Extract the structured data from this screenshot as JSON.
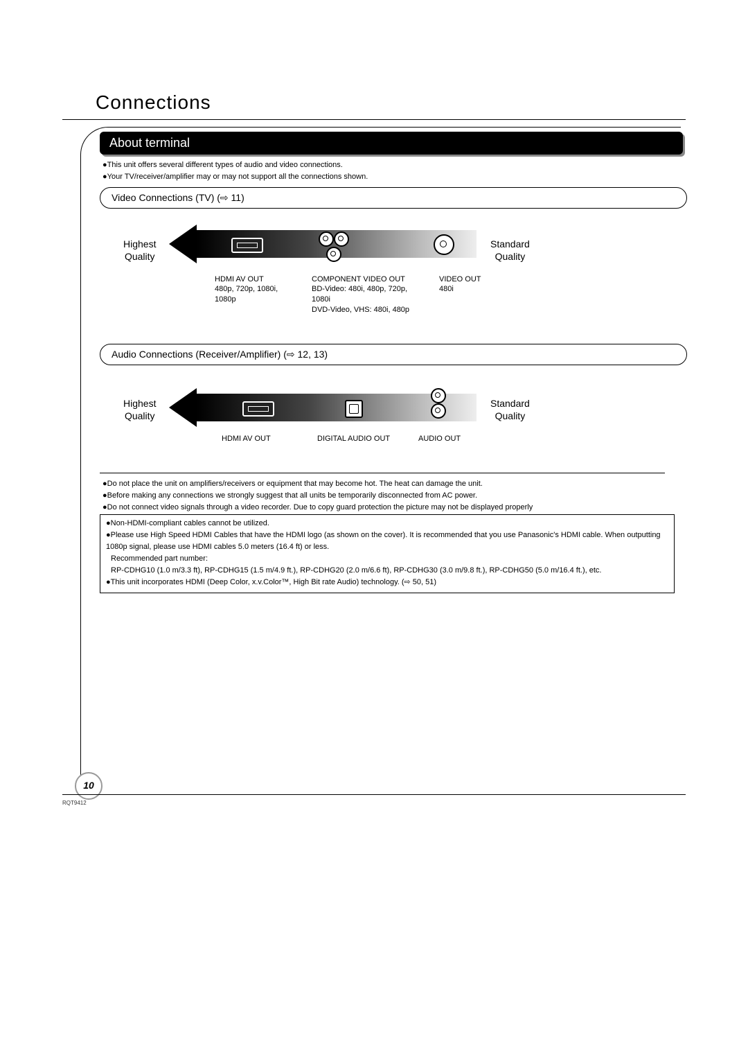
{
  "title": "Connections",
  "section_header": "About terminal",
  "intro_bullets": [
    "This unit offers several different types of audio and video connections.",
    "Your TV/receiver/amplifier may or may not support all the connections shown."
  ],
  "video": {
    "pill": "Video Connections (TV) (⇨ 11)",
    "highest": "Highest\nQuality",
    "standard": "Standard\nQuality",
    "cols": [
      {
        "name": "HDMI AV OUT",
        "detail": "480p, 720p, 1080i,\n1080p"
      },
      {
        "name": "COMPONENT VIDEO OUT",
        "detail": "BD-Video: 480i, 480p, 720p,\n1080i\nDVD-Video, VHS: 480i, 480p"
      },
      {
        "name": "VIDEO OUT",
        "detail": "480i"
      }
    ]
  },
  "audio": {
    "pill": "Audio Connections (Receiver/Amplifier) (⇨ 12, 13)",
    "highest": "Highest\nQuality",
    "standard": "Standard\nQuality",
    "cols": [
      {
        "name": "HDMI AV OUT"
      },
      {
        "name": "DIGITAL AUDIO OUT"
      },
      {
        "name": "AUDIO OUT"
      }
    ]
  },
  "warnings": [
    "Do not place the unit on amplifiers/receivers or equipment that may become hot. The heat can damage the unit.",
    "Before making any connections we strongly suggest that all units be temporarily disconnected from AC power.",
    "Do not connect video signals through a video recorder. Due to copy guard protection the picture may not be displayed properly"
  ],
  "hdmi_box": [
    "Non-HDMI-compliant cables cannot be utilized.",
    "Please use High Speed HDMI Cables that have the HDMI logo (as shown on the cover). It is recommended that you use Panasonic's HDMI cable. When outputting 1080p signal, please use HDMI cables 5.0 meters (16.4 ft) or less.",
    "Recommended part number:",
    "RP-CDHG10 (1.0 m/3.3 ft), RP-CDHG15 (1.5 m/4.9 ft.), RP-CDHG20 (2.0 m/6.6 ft), RP-CDHG30 (3.0 m/9.8 ft.), RP-CDHG50 (5.0 m/16.4 ft.), etc.",
    "This unit incorporates HDMI (Deep Color, x.v.Color™, High Bit rate Audio) technology. (⇨ 50, 51)"
  ],
  "page_number": "10",
  "doc_code": "RQT9412"
}
